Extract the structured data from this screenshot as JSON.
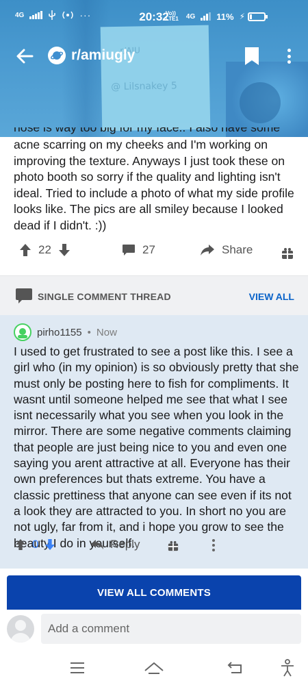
{
  "status_bar": {
    "network": "4G",
    "time": "20:32",
    "volte": "Vo)) LTE1",
    "network_right": "4G",
    "battery": "11%"
  },
  "toolbar": {
    "subreddit": "r/amiugly",
    "back_icon": "arrow-left-icon",
    "bookmark_icon": "bookmark-icon",
    "more_icon": "more-vertical-icon"
  },
  "header_photo": {
    "note_text_1": "r/AIU",
    "note_text_2": "@ Lilsnakey 5"
  },
  "post": {
    "partial_top_line": "nose is way too big for my face.. I also have some",
    "body": "acne scarring on my cheeks and I'm working on improving the texture. Anyways I just took these on photo booth so sorry if the quality and lighting isn't ideal. Tried to include a photo of what my side profile looks like. The pics are all smiley because I looked dead if I didn't. :))",
    "score": "22",
    "comments": "27",
    "share_label": "Share"
  },
  "thread_banner": {
    "label": "SINGLE COMMENT THREAD",
    "view_all": "VIEW ALL"
  },
  "comment": {
    "author": "pirho1155",
    "separator": "•",
    "age": "Now",
    "body": "I used to get frustrated to see a post like this. I see a girl who (in my opinion) is so obviously pretty that she must only be posting here to fish for compliments. It wasnt until someone helped me see that what I see isnt necessarily what you see when you look in the mirror. There are some negative comments claiming that people are just being nice to you and even one saying you arent attractive at all.  Everyone has their own preferences but thats extreme. You have a classic prettiness that anyone can see even if its not a look they are attracted to you. In short no you are not ugly, far from it, and i hope you grow to see the beauty I do in yourself.",
    "score": "0",
    "reply_label": "Reply"
  },
  "view_all_comments": "VIEW ALL COMMENTS",
  "add_comment_placeholder": "Add a comment",
  "colors": {
    "accent_blue": "#0a43ad",
    "link_blue": "#0a63c9",
    "comment_bg": "#dfe9f3",
    "upvote_gray": "#555555",
    "downvote_blue": "#3b82f6"
  }
}
